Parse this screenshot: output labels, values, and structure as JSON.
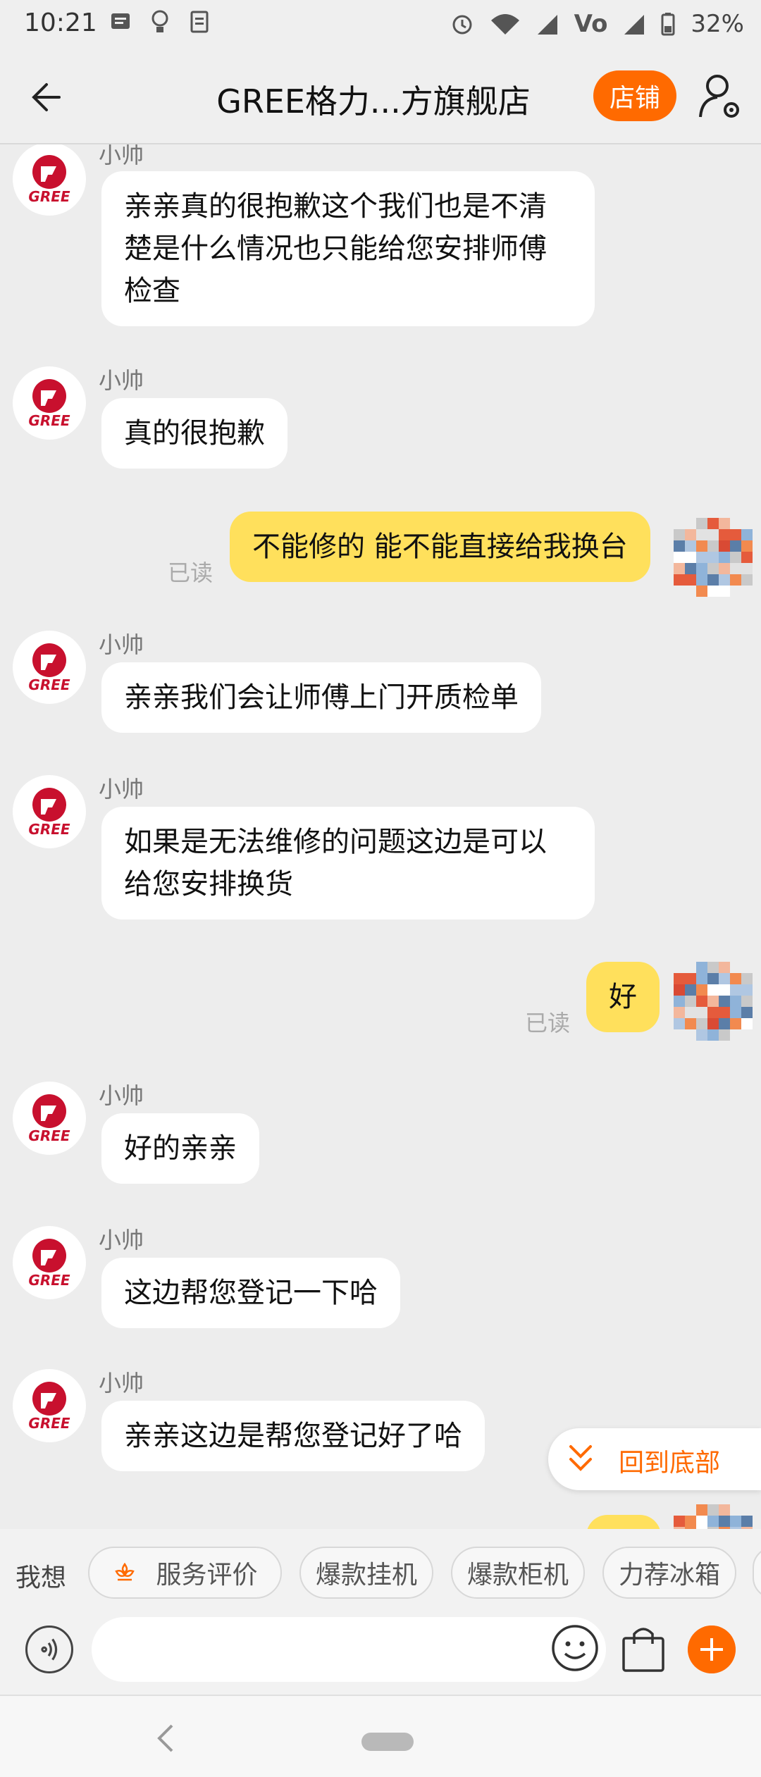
{
  "status_bar": {
    "time": "10:21",
    "battery": "32%",
    "network_label": "Vo",
    "left_icons": [
      "message-icon",
      "bulb-icon",
      "doc-icon"
    ],
    "right_icons": [
      "alarm-icon",
      "wifi-icon",
      "signal-icon",
      "volte-icon",
      "signal-icon",
      "battery-icon"
    ]
  },
  "header": {
    "title": "GREE格力...方旗舰店",
    "shop_button": "店铺",
    "accent_color": "#ff6a00"
  },
  "messages": [
    {
      "from": "shop",
      "sender": "小帅",
      "lines": [
        "亲亲真的很抱歉这个我们也是不清",
        "楚是什么情况也只能给您安排师傅",
        "检查"
      ]
    },
    {
      "from": "shop",
      "sender": "小帅",
      "lines": [
        "真的很抱歉"
      ]
    },
    {
      "from": "me",
      "read": "已读",
      "lines": [
        "不能修的 能不能直接给我换台"
      ]
    },
    {
      "from": "shop",
      "sender": "小帅",
      "lines": [
        "亲亲我们会让师傅上门开质检单"
      ]
    },
    {
      "from": "shop",
      "sender": "小帅",
      "lines": [
        "如果是无法维修的问题这边是可以",
        "给您安排换货"
      ]
    },
    {
      "from": "me",
      "read": "已读",
      "lines": [
        "好"
      ]
    },
    {
      "from": "shop",
      "sender": "小帅",
      "lines": [
        "好的亲亲"
      ]
    },
    {
      "from": "shop",
      "sender": "小帅",
      "lines": [
        "这边帮您登记一下哈"
      ]
    },
    {
      "from": "shop",
      "sender": "小帅",
      "lines": [
        "亲亲这边是帮您登记好了哈"
      ]
    }
  ],
  "scroll_to_bottom": "回到底部",
  "quick_bar": {
    "label": "我想",
    "chips": [
      "服务评价",
      "爆款挂机",
      "爆款柜机",
      "力荐冰箱"
    ]
  },
  "brand_logo_text": "GREE"
}
